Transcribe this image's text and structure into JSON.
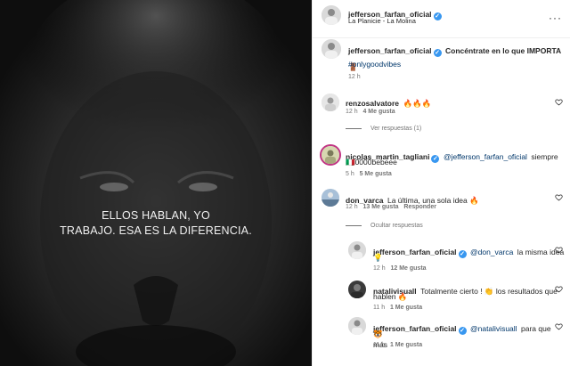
{
  "post_image": {
    "overlay_lines": [
      "ELLOS HABLAN, YO",
      "TRABAJO. ESA ES LA DIFERENCIA."
    ]
  },
  "header": {
    "username": "jefferson_farfan_oficial",
    "location": "La Planicie - La Molina",
    "more_icon": "ellipsis-icon"
  },
  "caption": {
    "username": "jefferson_farfan_oficial",
    "text": "Concéntrate en lo que IMPORTA",
    "emoji": "🚪",
    "hashtag": "#onlygoodvibes",
    "time": "12 h"
  },
  "comments": [
    {
      "username": "renzosalvatore",
      "text": "🔥🔥🔥",
      "time": "12 h",
      "likes": "4 Me gusta",
      "replies_toggle": "Ver respuestas (1)"
    },
    {
      "username": "nicolas_martin_tagliani",
      "mention": "@jefferson_farfan_oficial",
      "text": "siempre",
      "text2": "🇮🇹0000bebeee",
      "time": "5 h",
      "likes": "5 Me gusta"
    },
    {
      "username": "don_varca",
      "text": "La última, una sola idea 🔥",
      "time": "12 h",
      "likes": "13 Me gusta",
      "reply": "Responder",
      "replies_toggle": "Ocultar respuestas"
    }
  ],
  "replies": [
    {
      "username": "jefferson_farfan_oficial",
      "mention": "@don_varca",
      "text": "la misma idea",
      "text2": "💡",
      "time": "12 h",
      "likes": "12 Me gusta"
    },
    {
      "username": "natalivisuall",
      "text": "Totalmente cierto ! 👏 los resultados que",
      "text2": "hablen 🔥",
      "time": "11 h",
      "likes": "1 Me gusta"
    },
    {
      "username": "jefferson_farfan_oficial",
      "mention": "@natalivisuall",
      "text": "para que más",
      "text2": "🐯",
      "time": "11 h",
      "likes": "1 Me gusta"
    }
  ],
  "colors": {
    "verified": "#3897f0",
    "link": "#00376b",
    "muted": "#737373"
  }
}
